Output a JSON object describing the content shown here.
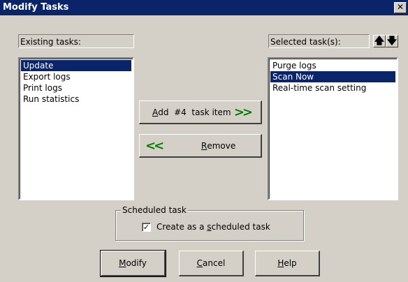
{
  "window": {
    "title": "Modify Tasks",
    "close_glyph": "✕"
  },
  "existing": {
    "label": "Existing tasks:",
    "items": [
      "Update",
      "Export logs",
      "Print logs",
      "Run statistics"
    ],
    "selected_index": 0
  },
  "selected": {
    "label": "Selected task(s):",
    "items": [
      "Purge logs",
      "Scan Now",
      "Real-time scan setting"
    ],
    "selected_index": 1,
    "up_glyph": "🡅",
    "down_glyph": "🡇"
  },
  "add_button": {
    "accel": "A",
    "rest": "dd  #4  task item",
    "arrow": ">>"
  },
  "remove_button": {
    "accel": "R",
    "rest": "emove",
    "arrow": "<<"
  },
  "scheduled": {
    "legend": "Scheduled task",
    "checked": true,
    "check_glyph": "✓",
    "label_pre": "Create as a ",
    "label_accel": "s",
    "label_post": "cheduled task"
  },
  "buttons": {
    "modify": {
      "accel": "M",
      "rest": "odify"
    },
    "cancel": {
      "accel": "C",
      "rest": "ancel"
    },
    "help": {
      "accel": "H",
      "rest": "elp"
    }
  }
}
